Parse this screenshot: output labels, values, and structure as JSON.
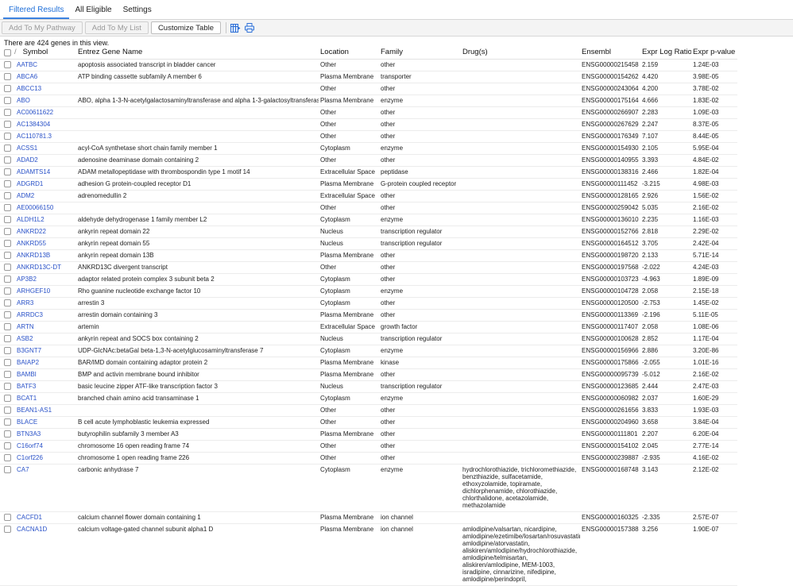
{
  "tabs": [
    {
      "label": "Filtered Results",
      "active": true
    },
    {
      "label": "All Eligible",
      "active": false
    },
    {
      "label": "Settings",
      "active": false
    }
  ],
  "toolbar": {
    "add_pathway": "Add To My Pathway",
    "add_list": "Add To My List",
    "customize": "Customize Table",
    "icons": [
      "column-chooser-icon",
      "print-icon"
    ]
  },
  "summary": "There are 424 genes in this view.",
  "table": {
    "columns": [
      "Symbol",
      "Entrez Gene Name",
      "Location",
      "Family",
      "Drug(s)",
      "Ensembl",
      "Expr Log Ratio",
      "Expr p-value"
    ],
    "sort_indicator": "/",
    "rows": [
      {
        "symbol": "AATBC",
        "name": "apoptosis associated transcript in bladder cancer",
        "location": "Other",
        "family": "other",
        "drugs": "",
        "ensembl": "ENSG00000215458",
        "ratio": "2.159",
        "pvalue": "1.24E-03"
      },
      {
        "symbol": "ABCA6",
        "name": "ATP binding cassette subfamily A member 6",
        "location": "Plasma Membrane",
        "family": "transporter",
        "drugs": "",
        "ensembl": "ENSG00000154262",
        "ratio": "4.420",
        "pvalue": "3.98E-05"
      },
      {
        "symbol": "ABCC13",
        "name": "",
        "location": "Other",
        "family": "other",
        "drugs": "",
        "ensembl": "ENSG00000243064",
        "ratio": "4.200",
        "pvalue": "3.78E-02"
      },
      {
        "symbol": "ABO",
        "name": "ABO, alpha 1-3-N-acetylgalactosaminyltransferase and alpha 1-3-galactosyltransferase",
        "location": "Plasma Membrane",
        "family": "enzyme",
        "drugs": "",
        "ensembl": "ENSG00000175164",
        "ratio": "4.666",
        "pvalue": "1.83E-02"
      },
      {
        "symbol": "AC00611622",
        "name": "",
        "location": "Other",
        "family": "other",
        "drugs": "",
        "ensembl": "ENSG00000266907",
        "ratio": "2.283",
        "pvalue": "1.09E-03"
      },
      {
        "symbol": "AC1384304",
        "name": "",
        "location": "Other",
        "family": "other",
        "drugs": "",
        "ensembl": "ENSG00000267629",
        "ratio": "2.247",
        "pvalue": "8.37E-05"
      },
      {
        "symbol": "AC110781.3",
        "name": "",
        "location": "Other",
        "family": "other",
        "drugs": "",
        "ensembl": "ENSG00000176349",
        "ratio": "7.107",
        "pvalue": "8.44E-05"
      },
      {
        "symbol": "ACSS1",
        "name": "acyl-CoA synthetase short chain family member 1",
        "location": "Cytoplasm",
        "family": "enzyme",
        "drugs": "",
        "ensembl": "ENSG00000154930",
        "ratio": "2.105",
        "pvalue": "5.95E-04"
      },
      {
        "symbol": "ADAD2",
        "name": "adenosine deaminase domain containing 2",
        "location": "Other",
        "family": "other",
        "drugs": "",
        "ensembl": "ENSG00000140955",
        "ratio": "3.393",
        "pvalue": "4.84E-02"
      },
      {
        "symbol": "ADAMTS14",
        "name": "ADAM metallopeptidase with thrombospondin type 1 motif 14",
        "location": "Extracellular Space",
        "family": "peptidase",
        "drugs": "",
        "ensembl": "ENSG00000138316",
        "ratio": "2.466",
        "pvalue": "1.82E-04"
      },
      {
        "symbol": "ADGRD1",
        "name": "adhesion G protein-coupled receptor D1",
        "location": "Plasma Membrane",
        "family": "G-protein coupled receptor",
        "drugs": "",
        "ensembl": "ENSG00000111452",
        "ratio": "-3.215",
        "pvalue": "4.98E-03"
      },
      {
        "symbol": "ADM2",
        "name": "adrenomedullin 2",
        "location": "Extracellular Space",
        "family": "other",
        "drugs": "",
        "ensembl": "ENSG00000128165",
        "ratio": "2.926",
        "pvalue": "1.56E-02"
      },
      {
        "symbol": "AE00066150",
        "name": "",
        "location": "Other",
        "family": "other",
        "drugs": "",
        "ensembl": "ENSG00000259042",
        "ratio": "5.035",
        "pvalue": "2.16E-02"
      },
      {
        "symbol": "ALDH1L2",
        "name": "aldehyde dehydrogenase 1 family member L2",
        "location": "Cytoplasm",
        "family": "enzyme",
        "drugs": "",
        "ensembl": "ENSG00000136010",
        "ratio": "2.235",
        "pvalue": "1.16E-03"
      },
      {
        "symbol": "ANKRD22",
        "name": "ankyrin repeat domain 22",
        "location": "Nucleus",
        "family": "transcription regulator",
        "drugs": "",
        "ensembl": "ENSG00000152766",
        "ratio": "2.818",
        "pvalue": "2.29E-02"
      },
      {
        "symbol": "ANKRD55",
        "name": "ankyrin repeat domain 55",
        "location": "Nucleus",
        "family": "transcription regulator",
        "drugs": "",
        "ensembl": "ENSG00000164512",
        "ratio": "3.705",
        "pvalue": "2.42E-04"
      },
      {
        "symbol": "ANKRD13B",
        "name": "ankyrin repeat domain 13B",
        "location": "Plasma Membrane",
        "family": "other",
        "drugs": "",
        "ensembl": "ENSG00000198720",
        "ratio": "2.133",
        "pvalue": "5.71E-14"
      },
      {
        "symbol": "ANKRD13C-DT",
        "name": "ANKRD13C divergent transcript",
        "location": "Other",
        "family": "other",
        "drugs": "",
        "ensembl": "ENSG00000197568",
        "ratio": "-2.022",
        "pvalue": "4.24E-03"
      },
      {
        "symbol": "AP3B2",
        "name": "adaptor related protein complex 3 subunit beta 2",
        "location": "Cytoplasm",
        "family": "other",
        "drugs": "",
        "ensembl": "ENSG00000103723",
        "ratio": "-4.963",
        "pvalue": "1.89E-09"
      },
      {
        "symbol": "ARHGEF10",
        "name": "Rho guanine nucleotide exchange factor 10",
        "location": "Cytoplasm",
        "family": "enzyme",
        "drugs": "",
        "ensembl": "ENSG00000104728",
        "ratio": "2.058",
        "pvalue": "2.15E-18"
      },
      {
        "symbol": "ARR3",
        "name": "arrestin 3",
        "location": "Cytoplasm",
        "family": "other",
        "drugs": "",
        "ensembl": "ENSG00000120500",
        "ratio": "-2.753",
        "pvalue": "1.45E-02"
      },
      {
        "symbol": "ARRDC3",
        "name": "arrestin domain containing 3",
        "location": "Plasma Membrane",
        "family": "other",
        "drugs": "",
        "ensembl": "ENSG00000113369",
        "ratio": "-2.196",
        "pvalue": "5.11E-05"
      },
      {
        "symbol": "ARTN",
        "name": "artemin",
        "location": "Extracellular Space",
        "family": "growth factor",
        "drugs": "",
        "ensembl": "ENSG00000117407",
        "ratio": "2.058",
        "pvalue": "1.08E-06"
      },
      {
        "symbol": "ASB2",
        "name": "ankyrin repeat and SOCS box containing 2",
        "location": "Nucleus",
        "family": "transcription regulator",
        "drugs": "",
        "ensembl": "ENSG00000100628",
        "ratio": "2.852",
        "pvalue": "1.17E-04"
      },
      {
        "symbol": "B3GNT7",
        "name": "UDP-GlcNAc:betaGal beta-1,3-N-acetylglucosaminyltransferase 7",
        "location": "Cytoplasm",
        "family": "enzyme",
        "drugs": "",
        "ensembl": "ENSG00000156966",
        "ratio": "2.886",
        "pvalue": "3.20E-86"
      },
      {
        "symbol": "BAIAP2",
        "name": "BAR/IMD domain containing adaptor protein 2",
        "location": "Plasma Membrane",
        "family": "kinase",
        "drugs": "",
        "ensembl": "ENSG00000175866",
        "ratio": "-2.055",
        "pvalue": "1.01E-16"
      },
      {
        "symbol": "BAMBI",
        "name": "BMP and activin membrane bound inhibitor",
        "location": "Plasma Membrane",
        "family": "other",
        "drugs": "",
        "ensembl": "ENSG00000095739",
        "ratio": "-5.012",
        "pvalue": "2.16E-02"
      },
      {
        "symbol": "BATF3",
        "name": "basic leucine zipper ATF-like transcription factor 3",
        "location": "Nucleus",
        "family": "transcription regulator",
        "drugs": "",
        "ensembl": "ENSG00000123685",
        "ratio": "2.444",
        "pvalue": "2.47E-03"
      },
      {
        "symbol": "BCAT1",
        "name": "branched chain amino acid transaminase 1",
        "location": "Cytoplasm",
        "family": "enzyme",
        "drugs": "",
        "ensembl": "ENSG00000060982",
        "ratio": "2.037",
        "pvalue": "1.60E-29"
      },
      {
        "symbol": "BEAN1-AS1",
        "name": "",
        "location": "Other",
        "family": "other",
        "drugs": "",
        "ensembl": "ENSG00000261656",
        "ratio": "3.833",
        "pvalue": "1.93E-03"
      },
      {
        "symbol": "BLACE",
        "name": "B cell acute lymphoblastic leukemia expressed",
        "location": "Other",
        "family": "other",
        "drugs": "",
        "ensembl": "ENSG00000204960",
        "ratio": "3.658",
        "pvalue": "3.84E-04"
      },
      {
        "symbol": "BTN3A3",
        "name": "butyrophilin subfamily 3 member A3",
        "location": "Plasma Membrane",
        "family": "other",
        "drugs": "",
        "ensembl": "ENSG00000111801",
        "ratio": "2.207",
        "pvalue": "6.20E-04"
      },
      {
        "symbol": "C16orf74",
        "name": "chromosome 16 open reading frame 74",
        "location": "Other",
        "family": "other",
        "drugs": "",
        "ensembl": "ENSG00000154102",
        "ratio": "2.045",
        "pvalue": "2.77E-14"
      },
      {
        "symbol": "C1orf226",
        "name": "chromosome 1 open reading frame 226",
        "location": "Other",
        "family": "other",
        "drugs": "",
        "ensembl": "ENSG00000239887",
        "ratio": "-2.935",
        "pvalue": "4.16E-02"
      },
      {
        "symbol": "CA7",
        "name": "carbonic anhydrase 7",
        "location": "Cytoplasm",
        "family": "enzyme",
        "drugs": "hydrochlorothiazide, trichloromethiazide, benzthiazide, sulfacetamide, ethoxyzolamide, topiramate, dichlorphenamide, chlorothiazide, chlorthalidone, acetazolamide, methazolamide",
        "ensembl": "ENSG00000168748",
        "ratio": "3.143",
        "pvalue": "2.12E-02"
      },
      {
        "symbol": "CACFD1",
        "name": "calcium channel flower domain containing 1",
        "location": "Plasma Membrane",
        "family": "ion channel",
        "drugs": "",
        "ensembl": "ENSG00000160325",
        "ratio": "-2.335",
        "pvalue": "2.57E-07"
      },
      {
        "symbol": "CACNA1D",
        "name": "calcium voltage-gated channel subunit alpha1 D",
        "location": "Plasma Membrane",
        "family": "ion channel",
        "drugs": "amlodipine/valsartan, nicardipine, amlodipine/ezetimibe/losartan/rosuvastatin, amlodipine/atorvastatin, aliskiren/amlodipine/hydrochlorothiazide, amlodipine/telmisartan, aliskiren/amlodipine, MEM-1003, isradipine, cinnarizine, nifedipine, amlodipine/perindopril,",
        "ensembl": "ENSG00000157388",
        "ratio": "3.256",
        "pvalue": "1.90E-07"
      }
    ]
  }
}
